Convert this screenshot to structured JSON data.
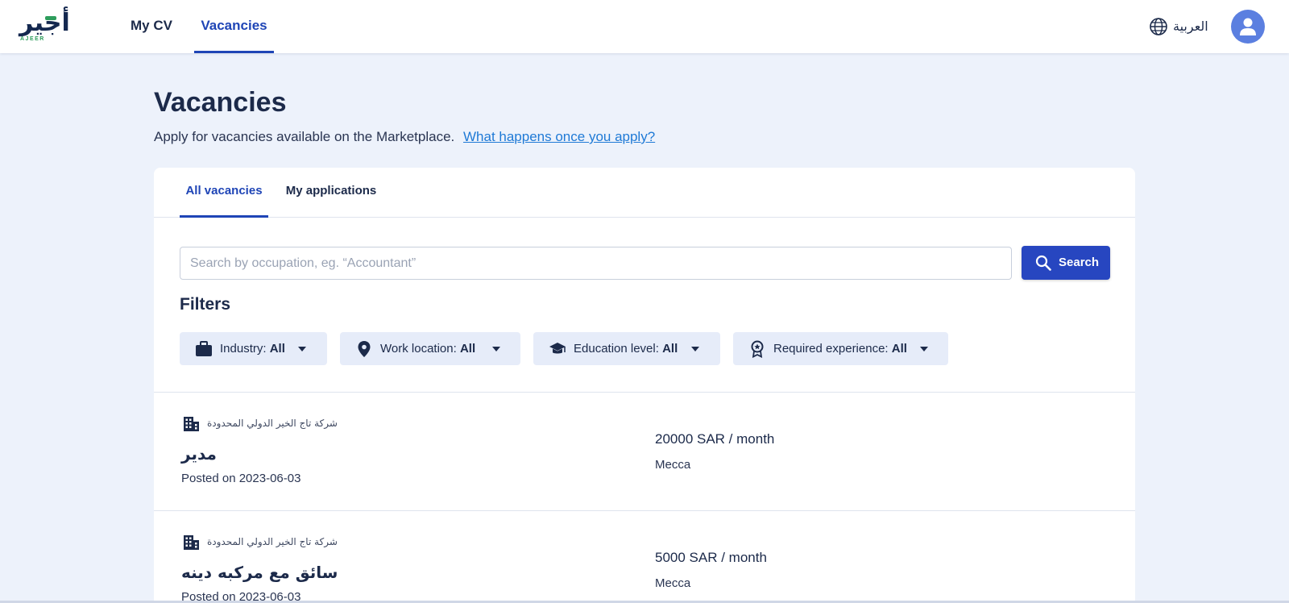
{
  "header": {
    "logo_ar": "أجير",
    "logo_en": "AJEER",
    "nav": [
      {
        "label": "My CV",
        "active": false
      },
      {
        "label": "Vacancies",
        "active": true
      }
    ],
    "language_label": "العربية",
    "language_icon": "globe-icon",
    "avatar_icon": "user-icon"
  },
  "page": {
    "title": "Vacancies",
    "subtitle": "Apply for vacancies available on the Marketplace.",
    "help_link": "What happens once you apply?"
  },
  "tabs": [
    {
      "label": "All vacancies",
      "active": true
    },
    {
      "label": "My applications",
      "active": false
    }
  ],
  "search": {
    "placeholder": "Search by occupation, eg. “Accountant”",
    "value": "",
    "button_label": "Search"
  },
  "filters": {
    "title": "Filters",
    "items": [
      {
        "label": "Industry:",
        "value": "All",
        "icon": "briefcase-icon"
      },
      {
        "label": "Work location:",
        "value": "All",
        "icon": "location-pin-icon"
      },
      {
        "label": "Education level:",
        "value": "All",
        "icon": "graduation-cap-icon"
      },
      {
        "label": "Required experience:",
        "value": "All",
        "icon": "badge-icon"
      }
    ]
  },
  "vacancies": [
    {
      "company": "شركة تاج الخير الدولي المحدودة",
      "title": "مدير",
      "posted": "Posted on 2023-06-03",
      "salary": "20000 SAR / month",
      "location": "Mecca"
    },
    {
      "company": "شركة تاج الخير الدولي المحدودة",
      "title": "سائق مع مركبه دينه",
      "posted": "Posted on 2023-06-03",
      "salary": "5000 SAR / month",
      "location": "Mecca"
    }
  ],
  "colors": {
    "accent": "#1f45b6",
    "button": "#2746c0",
    "background": "#edf2fb",
    "link": "#1f7ad6",
    "avatar": "#5b7fe0"
  }
}
